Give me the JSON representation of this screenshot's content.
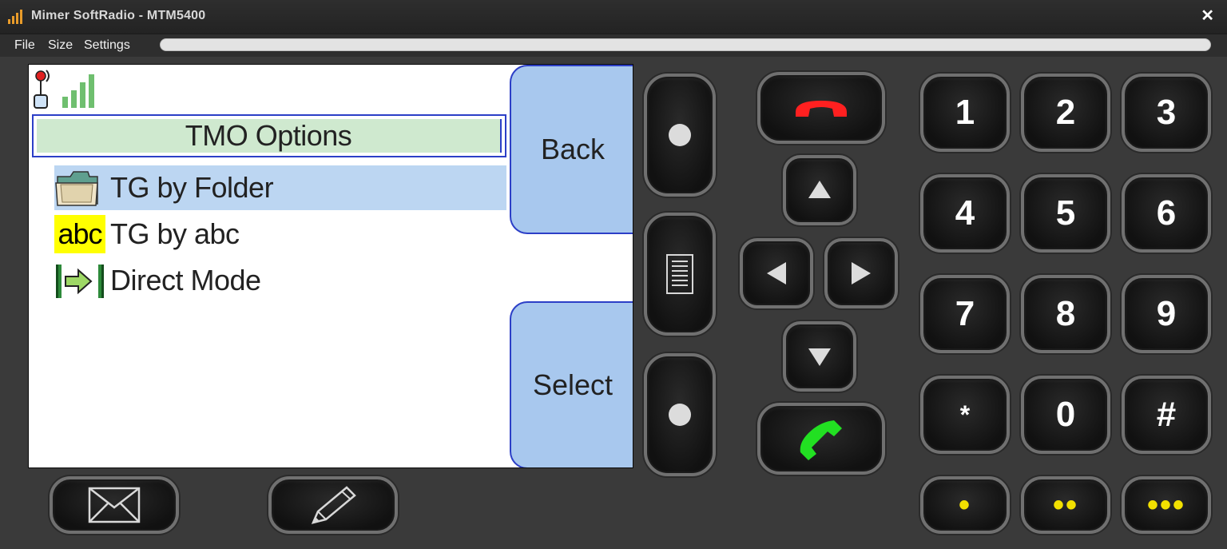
{
  "window": {
    "title": "Mimer SoftRadio - MTM5400",
    "close": "✕"
  },
  "menu": {
    "items": [
      "File",
      "Size",
      "Settings"
    ]
  },
  "screen": {
    "header": "TMO Options",
    "items": [
      {
        "label": "TG by Folder",
        "icon": "folder-icon",
        "selected": true
      },
      {
        "label": "TG by abc",
        "icon": "abc-icon",
        "icon_text": "abc",
        "selected": false
      },
      {
        "label": "Direct Mode",
        "icon": "direct-mode-icon",
        "selected": false
      }
    ],
    "softkeys": {
      "top": "Back",
      "bottom": "Select"
    }
  },
  "keypad": {
    "keys": [
      "1",
      "2",
      "3",
      "4",
      "5",
      "6",
      "7",
      "8",
      "9",
      "*",
      "0",
      "#"
    ],
    "dot_keys": [
      "•",
      "••",
      "•••"
    ]
  },
  "colors": {
    "end_call": "#ff2020",
    "start_call": "#22e022",
    "header_bg": "#cfe9cf",
    "selected_row": "#bcd6f2",
    "softkey_bg": "#a8c8ee",
    "accent_blue": "#2c3fc7",
    "abc_yellow": "#ffff00",
    "dot_key_yellow": "#f2e000"
  }
}
